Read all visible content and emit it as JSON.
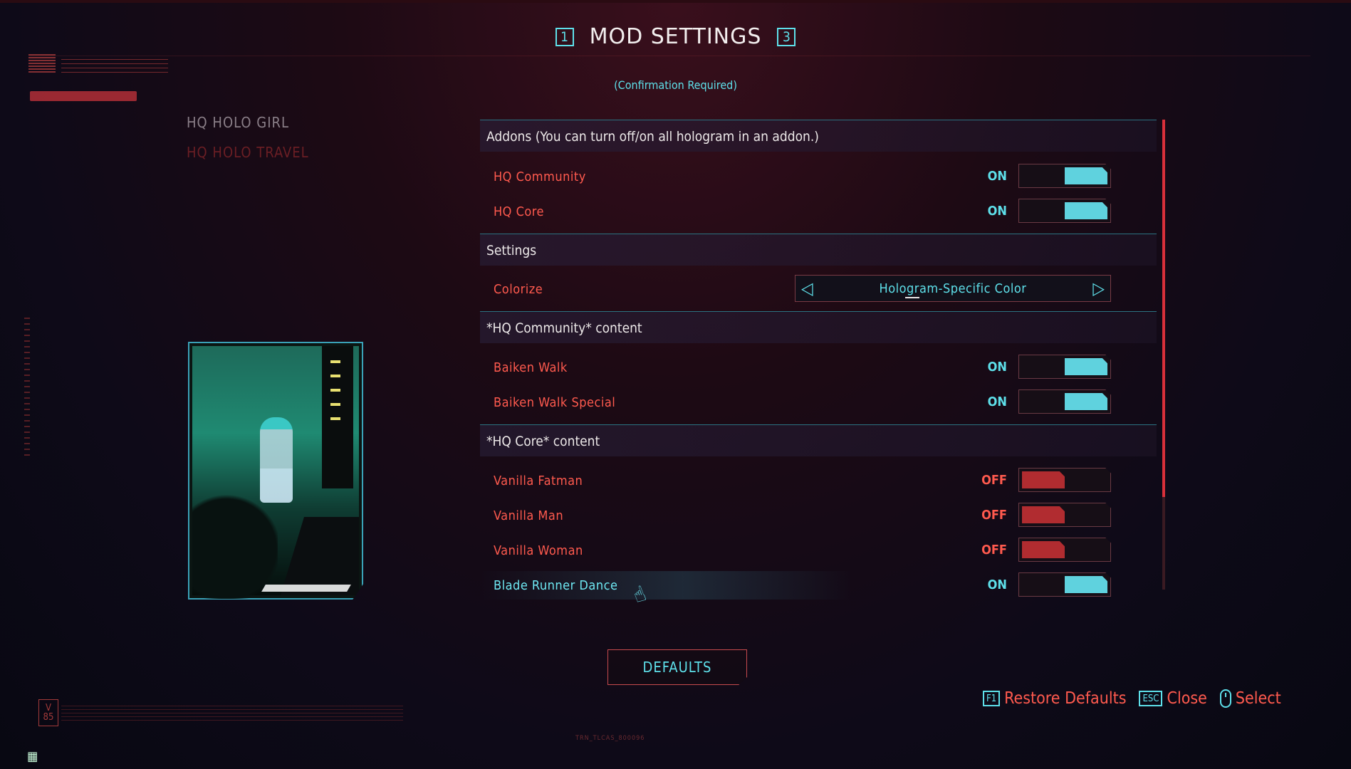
{
  "header": {
    "left_key": "1",
    "title": "MOD SETTINGS",
    "right_key": "3",
    "subtitle": "(Confirmation Required)"
  },
  "mod_list": [
    {
      "label": "HQ HOLO GIRL"
    },
    {
      "label": "HQ HOLO TRAVEL"
    }
  ],
  "sections": {
    "addons": {
      "title": "Addons (You can turn off/on all hologram in an addon.)",
      "rows": [
        {
          "label": "HQ Community",
          "state": "ON"
        },
        {
          "label": "HQ Core",
          "state": "ON"
        }
      ]
    },
    "settings": {
      "title": "Settings",
      "colorize": {
        "label": "Colorize",
        "value": "Hologram-Specific Color"
      }
    },
    "community": {
      "title": "*HQ Community* content",
      "rows": [
        {
          "label": "Baiken Walk",
          "state": "ON"
        },
        {
          "label": "Baiken Walk Special",
          "state": "ON"
        }
      ]
    },
    "core": {
      "title": "*HQ Core* content",
      "rows": [
        {
          "label": "Vanilla Fatman",
          "state": "OFF"
        },
        {
          "label": "Vanilla Man",
          "state": "OFF"
        },
        {
          "label": "Vanilla Woman",
          "state": "OFF"
        },
        {
          "label": "Blade Runner Dance",
          "state": "ON"
        }
      ]
    }
  },
  "defaults_button": "DEFAULTS",
  "hints": {
    "restore_key": "F1",
    "restore_label": "Restore Defaults",
    "close_key": "ESC",
    "close_label": "Close",
    "select_label": "Select"
  },
  "badge": "V 85",
  "bottom_tag": "TRN_TLCAS_800096",
  "colors": {
    "accent_cyan": "#5ee0ea",
    "accent_red": "#ff5a4e",
    "off_knob": "#b12c30",
    "on_knob": "#5fd2de"
  }
}
